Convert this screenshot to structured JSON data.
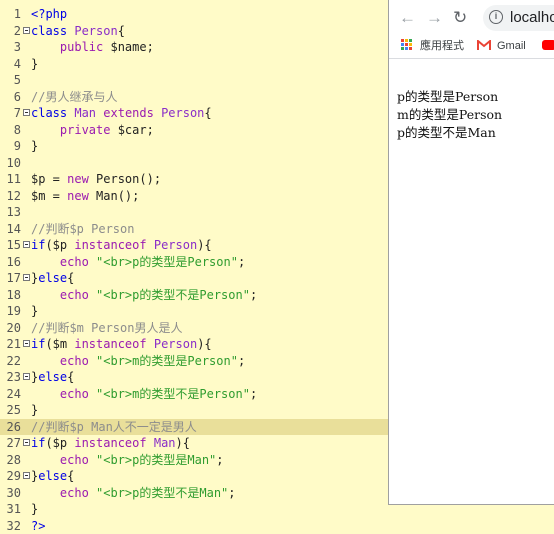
{
  "editor": {
    "lines": [
      {
        "n": "1",
        "fold": false,
        "hl": false,
        "tokens": [
          {
            "c": "kw",
            "t": "<?php"
          }
        ]
      },
      {
        "n": "2",
        "fold": true,
        "hl": false,
        "tokens": [
          {
            "c": "kw",
            "t": "class "
          },
          {
            "c": "cls",
            "t": "Person"
          },
          {
            "c": "var",
            "t": "{"
          }
        ]
      },
      {
        "n": "3",
        "fold": false,
        "hl": false,
        "tokens": [
          {
            "c": "var",
            "t": "    "
          },
          {
            "c": "kw2",
            "t": "public "
          },
          {
            "c": "var",
            "t": "$name;"
          }
        ]
      },
      {
        "n": "4",
        "fold": false,
        "hl": false,
        "tokens": [
          {
            "c": "var",
            "t": "}"
          }
        ]
      },
      {
        "n": "5",
        "fold": false,
        "hl": false,
        "tokens": []
      },
      {
        "n": "6",
        "fold": false,
        "hl": false,
        "tokens": [
          {
            "c": "cm",
            "t": "//男人继承与人"
          }
        ]
      },
      {
        "n": "7",
        "fold": true,
        "hl": false,
        "tokens": [
          {
            "c": "kw",
            "t": "class "
          },
          {
            "c": "cls",
            "t": "Man "
          },
          {
            "c": "kw2",
            "t": "extends "
          },
          {
            "c": "cls",
            "t": "Person"
          },
          {
            "c": "var",
            "t": "{"
          }
        ]
      },
      {
        "n": "8",
        "fold": false,
        "hl": false,
        "tokens": [
          {
            "c": "var",
            "t": "    "
          },
          {
            "c": "kw2",
            "t": "private "
          },
          {
            "c": "var",
            "t": "$car;"
          }
        ]
      },
      {
        "n": "9",
        "fold": false,
        "hl": false,
        "tokens": [
          {
            "c": "var",
            "t": "}"
          }
        ]
      },
      {
        "n": "10",
        "fold": false,
        "hl": false,
        "tokens": []
      },
      {
        "n": "11",
        "fold": false,
        "hl": false,
        "tokens": [
          {
            "c": "var",
            "t": "$p = "
          },
          {
            "c": "kw2",
            "t": "new "
          },
          {
            "c": "var",
            "t": "Person();"
          }
        ]
      },
      {
        "n": "12",
        "fold": false,
        "hl": false,
        "tokens": [
          {
            "c": "var",
            "t": "$m = "
          },
          {
            "c": "kw2",
            "t": "new "
          },
          {
            "c": "var",
            "t": "Man();"
          }
        ]
      },
      {
        "n": "13",
        "fold": false,
        "hl": false,
        "tokens": []
      },
      {
        "n": "14",
        "fold": false,
        "hl": false,
        "tokens": [
          {
            "c": "cm",
            "t": "//判断$p Person"
          }
        ]
      },
      {
        "n": "15",
        "fold": true,
        "hl": false,
        "tokens": [
          {
            "c": "kw",
            "t": "if"
          },
          {
            "c": "var",
            "t": "($p "
          },
          {
            "c": "kw2",
            "t": "instanceof "
          },
          {
            "c": "cls",
            "t": "Person"
          },
          {
            "c": "var",
            "t": "){"
          }
        ]
      },
      {
        "n": "16",
        "fold": false,
        "hl": false,
        "tokens": [
          {
            "c": "var",
            "t": "    "
          },
          {
            "c": "kw2",
            "t": "echo "
          },
          {
            "c": "str",
            "t": "\"<br>p的类型是Person\""
          },
          {
            "c": "var",
            "t": ";"
          }
        ]
      },
      {
        "n": "17",
        "fold": true,
        "hl": false,
        "tokens": [
          {
            "c": "var",
            "t": "}"
          },
          {
            "c": "kw",
            "t": "else"
          },
          {
            "c": "var",
            "t": "{"
          }
        ]
      },
      {
        "n": "18",
        "fold": false,
        "hl": false,
        "tokens": [
          {
            "c": "var",
            "t": "    "
          },
          {
            "c": "kw2",
            "t": "echo "
          },
          {
            "c": "str",
            "t": "\"<br>p的类型不是Person\""
          },
          {
            "c": "var",
            "t": ";"
          }
        ]
      },
      {
        "n": "19",
        "fold": false,
        "hl": false,
        "tokens": [
          {
            "c": "var",
            "t": "}"
          }
        ]
      },
      {
        "n": "20",
        "fold": false,
        "hl": false,
        "tokens": [
          {
            "c": "cm",
            "t": "//判断$m Person男人是人"
          }
        ]
      },
      {
        "n": "21",
        "fold": true,
        "hl": false,
        "tokens": [
          {
            "c": "kw",
            "t": "if"
          },
          {
            "c": "var",
            "t": "($m "
          },
          {
            "c": "kw2",
            "t": "instanceof "
          },
          {
            "c": "cls",
            "t": "Person"
          },
          {
            "c": "var",
            "t": "){"
          }
        ]
      },
      {
        "n": "22",
        "fold": false,
        "hl": false,
        "tokens": [
          {
            "c": "var",
            "t": "    "
          },
          {
            "c": "kw2",
            "t": "echo "
          },
          {
            "c": "str",
            "t": "\"<br>m的类型是Person\""
          },
          {
            "c": "var",
            "t": ";"
          }
        ]
      },
      {
        "n": "23",
        "fold": true,
        "hl": false,
        "tokens": [
          {
            "c": "var",
            "t": "}"
          },
          {
            "c": "kw",
            "t": "else"
          },
          {
            "c": "var",
            "t": "{"
          }
        ]
      },
      {
        "n": "24",
        "fold": false,
        "hl": false,
        "tokens": [
          {
            "c": "var",
            "t": "    "
          },
          {
            "c": "kw2",
            "t": "echo "
          },
          {
            "c": "str",
            "t": "\"<br>m的类型不是Person\""
          },
          {
            "c": "var",
            "t": ";"
          }
        ]
      },
      {
        "n": "25",
        "fold": false,
        "hl": false,
        "tokens": [
          {
            "c": "var",
            "t": "}"
          }
        ]
      },
      {
        "n": "26",
        "fold": false,
        "hl": true,
        "tokens": [
          {
            "c": "cm",
            "t": "//判断$p Man人不一定是男人"
          }
        ]
      },
      {
        "n": "27",
        "fold": true,
        "hl": false,
        "tokens": [
          {
            "c": "kw",
            "t": "if"
          },
          {
            "c": "var",
            "t": "($p "
          },
          {
            "c": "kw2",
            "t": "instanceof "
          },
          {
            "c": "cls",
            "t": "Man"
          },
          {
            "c": "var",
            "t": "){"
          }
        ]
      },
      {
        "n": "28",
        "fold": false,
        "hl": false,
        "tokens": [
          {
            "c": "var",
            "t": "    "
          },
          {
            "c": "kw2",
            "t": "echo "
          },
          {
            "c": "str",
            "t": "\"<br>p的类型是Man\""
          },
          {
            "c": "var",
            "t": ";"
          }
        ]
      },
      {
        "n": "29",
        "fold": true,
        "hl": false,
        "tokens": [
          {
            "c": "var",
            "t": "}"
          },
          {
            "c": "kw",
            "t": "else"
          },
          {
            "c": "var",
            "t": "{"
          }
        ]
      },
      {
        "n": "30",
        "fold": false,
        "hl": false,
        "tokens": [
          {
            "c": "var",
            "t": "    "
          },
          {
            "c": "kw2",
            "t": "echo "
          },
          {
            "c": "str",
            "t": "\"<br>p的类型不是Man\""
          },
          {
            "c": "var",
            "t": ";"
          }
        ]
      },
      {
        "n": "31",
        "fold": false,
        "hl": false,
        "tokens": [
          {
            "c": "var",
            "t": "}"
          }
        ]
      },
      {
        "n": "32",
        "fold": false,
        "hl": false,
        "tokens": [
          {
            "c": "kw",
            "t": "?>"
          }
        ]
      }
    ]
  },
  "browser": {
    "url": "localho",
    "bookmarks": {
      "apps": "應用程式",
      "gmail": "Gmail"
    },
    "output": [
      "p的类型是Person",
      "m的类型是Person",
      "p的类型不是Man"
    ]
  }
}
